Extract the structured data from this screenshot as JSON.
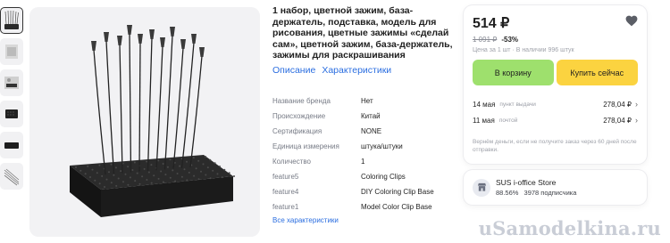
{
  "product": {
    "title": "1 набор, цветной зажим, база-держатель, подставка, модель для рисования, цветные зажимы «сделай сам», цветной зажим, база-держатель, зажимы для раскрашивания",
    "tabs": [
      {
        "label": "Описание"
      },
      {
        "label": "Характеристики"
      }
    ]
  },
  "specs": [
    {
      "name": "Название бренда",
      "value": "Нет"
    },
    {
      "name": "Происхождение",
      "value": "Китай"
    },
    {
      "name": "Сертификация",
      "value": "NONE"
    },
    {
      "name": "Единица измерения",
      "value": "штука/штуки"
    },
    {
      "name": "Количество",
      "value": "1"
    },
    {
      "name": "feature5",
      "value": "Coloring Clips"
    },
    {
      "name": "feature4",
      "value": "DIY Coloring Clip Base"
    },
    {
      "name": "feature1",
      "value": "Model Color Clip Base"
    }
  ],
  "all_specs_link": "Все характеристики",
  "buy": {
    "price": "514 ₽",
    "old_price": "1 091 ₽",
    "discount": "-53%",
    "meta": "Цена за 1 шт · В наличии 996 штук",
    "cart_label": "В корзину",
    "buy_now_label": "Купить сейчас",
    "delivery": [
      {
        "date": "14 мая",
        "type": "пункт выдачи",
        "price": "278,04 ₽"
      },
      {
        "date": "11 мая",
        "type": "почтой",
        "price": "278,04 ₽"
      }
    ],
    "refund": "Вернём деньги, если не получите заказ через 60 дней после отправки."
  },
  "store": {
    "name": "SUS i-office Store",
    "rating": "88.56%",
    "subscribers": "3978 подписчика"
  },
  "watermark": "uSamodelkina.ru",
  "colors": {
    "cart_button": "#9ee06d",
    "buy_button": "#fbd340",
    "link": "#2b6ee0"
  },
  "icons": [
    "heart-icon",
    "chevron-right-icon",
    "store-icon"
  ]
}
